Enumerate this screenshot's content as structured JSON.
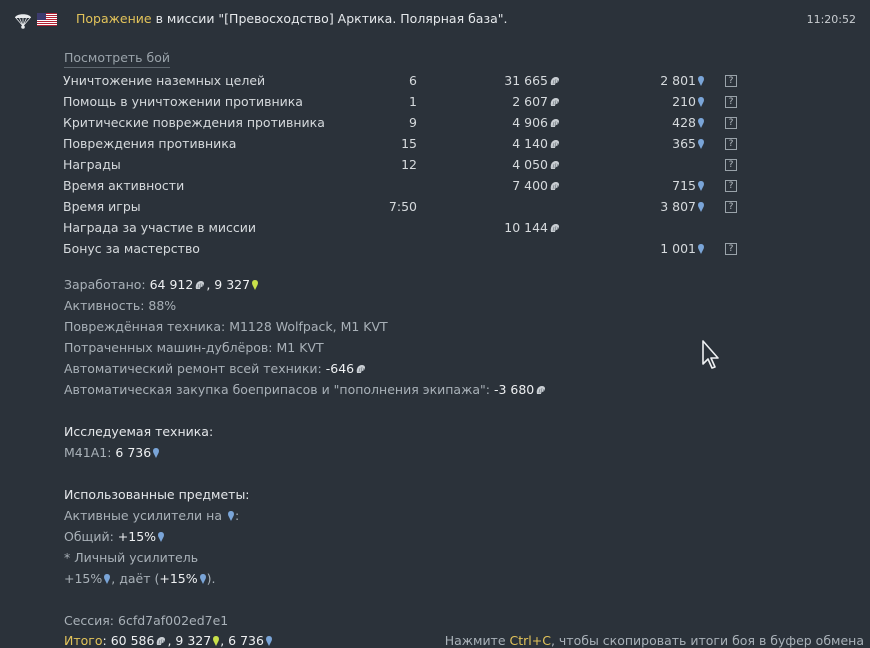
{
  "header": {
    "defeat_word": "Поражение",
    "mission_text": " в миссии \"[Превосходство] Арктика. Полярная база\".",
    "time": "11:20:52",
    "icons": [
      "parachute-icon",
      "us-flag-icon"
    ]
  },
  "view_battle": "Посмотреть бой",
  "rows": [
    {
      "label": "Уничтожение наземных целей",
      "count": "6",
      "sl": "31 665",
      "rp": "2 801"
    },
    {
      "label": "Помощь в уничтожении противника",
      "count": "1",
      "sl": "2 607",
      "rp": "210"
    },
    {
      "label": "Критические повреждения противника",
      "count": "9",
      "sl": "4 906",
      "rp": "428"
    },
    {
      "label": "Повреждения противника",
      "count": "15",
      "sl": "4 140",
      "rp": "365"
    },
    {
      "label": "Награды",
      "count": "12",
      "sl": "4 050",
      "rp": ""
    },
    {
      "label": "Время активности",
      "count": "",
      "sl": "7 400",
      "rp": "715"
    },
    {
      "label": "Время игры",
      "count": "7:50",
      "sl": "",
      "rp": "3 807"
    },
    {
      "label": "Награда за участие в миссии",
      "count": "",
      "sl": "10 144",
      "rp": ""
    },
    {
      "label": "Бонус за мастерство",
      "count": "",
      "sl": "",
      "rp": "1 001"
    }
  ],
  "question_mark": "?",
  "summary": {
    "earned_label": "Заработано: ",
    "earned_sl": "64 912",
    "earned_sep": ", ",
    "earned_ge": "9 327",
    "activity": "Активность: 88%",
    "damaged_vehicles": "Повреждённая техника: M1128 Wolfpack, M1 KVT",
    "backups_used": "Потраченных машин-дублёров: M1 KVT",
    "auto_repair_label": "Автоматический ремонт всей техники: ",
    "auto_repair_value": "-646",
    "auto_purchase_label": "Автоматическая закупка боеприпасов и \"пополнения экипажа\": ",
    "auto_purchase_value": "-3 680"
  },
  "research": {
    "heading": "Исследуемая техника:",
    "vehicle_label": "M41A1: ",
    "vehicle_value": "6 736"
  },
  "items": {
    "heading": "Использованные предметы:",
    "active_boosters": "Активные усилители на ",
    "general_label": "Общий: ",
    "general_value": "+15%",
    "personal": "* Личный усилитель",
    "personal_value": "+15%",
    "gives_label": ", даёт (",
    "gives_value": "+15%",
    "gives_end": ")."
  },
  "session": "Сессия: 6cfd7af002ed7e1",
  "footer": {
    "total_label": "Итого",
    "total_colon": ": ",
    "total_sl": "60 586",
    "sep1": ", ",
    "total_ge": "9 327",
    "sep2": ", ",
    "total_rp": "6 736",
    "hint_before": "Нажмите ",
    "hint_key": "Ctrl+C",
    "hint_after": ", чтобы скопировать итоги боя в буфер обмена"
  },
  "colors": {
    "accent": "#e2c35a",
    "background": "#2b323a",
    "rp_icon": "#7aa5d8",
    "ge_icon": "#c8e04a"
  }
}
